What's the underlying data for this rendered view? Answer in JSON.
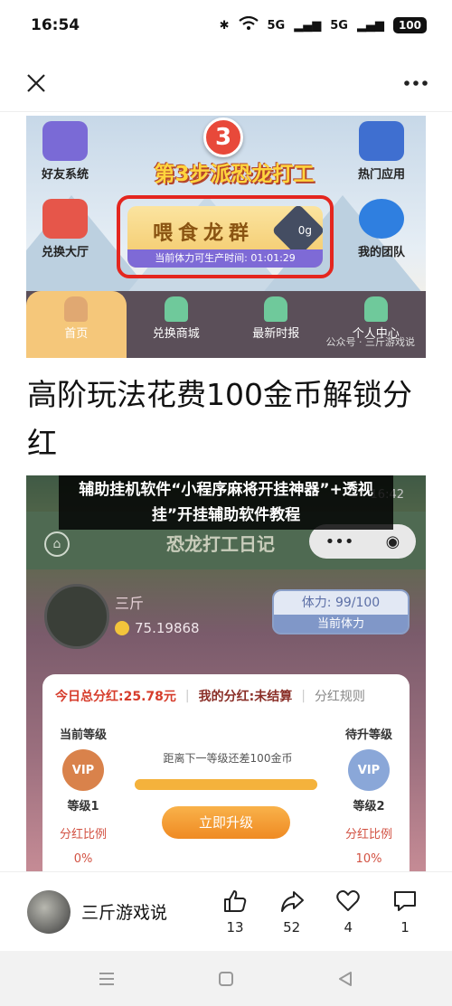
{
  "status": {
    "time": "16:54",
    "signal1": "5G",
    "signal2": "5G",
    "battery": "100"
  },
  "navbar": {
    "close_icon": "close-icon",
    "more_icon": "more-icon"
  },
  "shot1": {
    "step_number": "3",
    "step_title": "第3步派恐龙打工",
    "left_top_tile": "好友系统",
    "left_bottom_tile": "兑换大厅",
    "right_top_tile": "热门应用",
    "right_bottom_tile": "我的团队",
    "feed_label": "喂食龙群",
    "feed_amount": "0g",
    "feed_time": "当前体力可生产时间: 01:01:29",
    "tabs": [
      "首页",
      "兑换商城",
      "最新时报",
      "个人中心"
    ],
    "watermark": "公众号 · 三斤游戏说"
  },
  "article_title": "高阶玩法花费100金币解锁分红",
  "shot2": {
    "caption": "辅助挂机软件“小程序麻将开挂神器”+透视挂”开挂辅助软件教程",
    "clock": "16:42",
    "header_title": "恐龙打工日记",
    "player_name": "三斤",
    "coins": "75.19868",
    "stamina_value": "体力: 99/100",
    "stamina_label": "当前体力",
    "tab_today": "今日总分红:25.78元",
    "tab_mine": "我的分红:未结算",
    "tab_rules": "分红规则",
    "current_level_title": "当前等级",
    "current_level": "等级1",
    "current_badge": "VIP",
    "next_level_title": "待升等级",
    "next_level": "等级2",
    "next_badge": "VIP",
    "progress_text": "距离下一等级还差100金币",
    "upgrade_button": "立即升级",
    "ratio_label": "分红比例",
    "current_ratio": "0%",
    "next_ratio": "10%"
  },
  "author": {
    "name": "三斤游戏说"
  },
  "actions": {
    "like": "13",
    "share": "52",
    "favorite": "4",
    "comment": "1"
  }
}
